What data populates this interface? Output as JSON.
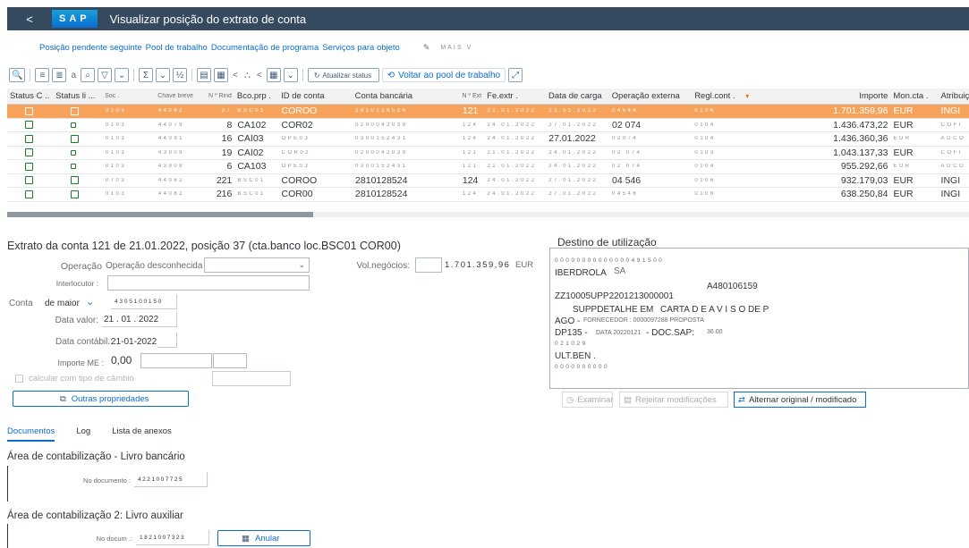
{
  "shell": {
    "back": "<",
    "logo": "SAP",
    "title": "Visualizar posição do extrato de conta"
  },
  "appmenu": {
    "items": [
      "Posição pendente seguinte",
      "Pool de trabalho",
      "Documentação de programa",
      "Serviços para objeto"
    ],
    "more": "MAIS V"
  },
  "toolbar": {
    "a_label": "a",
    "refresh_label": "Atualizar status",
    "back_pool_label": "Voltar ao pool de trabalho"
  },
  "table": {
    "columns": [
      "Status C ..",
      "Status li ...",
      "Soc .",
      "Chave breve",
      "N º Rind",
      "Bco.prp .",
      "ID de conta",
      "Conta bancária",
      "N º Ext",
      "Fe.extr .",
      "Data de carga",
      "Operação externa",
      "Regl.cont .",
      "Importe",
      "Mon.cta .",
      "Atribuição"
    ],
    "rows": [
      {
        "soc": "0103",
        "chave": "44062",
        "rind": "37",
        "bco": "BSC01",
        "idconta": "COROO",
        "conta": "2810128524",
        "ext": "121",
        "fe": "21.01.2022",
        "carga": "21.01.2022",
        "op": "04546",
        "regl": "0106",
        "importe": "1.701.359,96",
        "moneda": "EUR",
        "atrib": "INGI"
      },
      {
        "soc": "0103",
        "chave": "44079",
        "rind": "8",
        "bco": "CA102",
        "idconta": "COR02",
        "conta": "0200042039",
        "ext": "124",
        "fe": "24.01.2022",
        "carga": "27.01.2022",
        "op": "02 074",
        "regl": "0104",
        "importe": "1.436.473,22",
        "moneda": "EUR",
        "atrib": "COFI"
      },
      {
        "soc": "0103",
        "chave": "44091",
        "rind": "16",
        "bco": "CAI03",
        "idconta": "OPE03",
        "conta": "0300152431",
        "ext": "124",
        "fe": "24.01.2022",
        "carga": "27.01.2022",
        "op": "02074",
        "regl": "0104",
        "importe": "1.436.360,36",
        "moneda": "EUR",
        "atrib": "AGCO"
      },
      {
        "soc": "0103",
        "chave": "43909",
        "rind": "19",
        "bco": "CAI02",
        "idconta": "COR02",
        "conta": "0200042039",
        "ext": "121",
        "fe": "21.01.2022",
        "carga": "24.01.2022",
        "op": "02 074",
        "regl": "0103",
        "importe": "1.043.137,33",
        "moneda": "EUR",
        "atrib": "COFI"
      },
      {
        "soc": "0103",
        "chave": "43908",
        "rind": "6",
        "bco": "CA103",
        "idconta": "OPE03",
        "conta": "0300152431",
        "ext": "121",
        "fe": "21.01.2022",
        "carga": "24.01.2022",
        "op": "02 074",
        "regl": "0104",
        "importe": "955.292,66",
        "moneda": "EUR",
        "atrib": "AGCO"
      },
      {
        "soc": "0703",
        "chave": "44062",
        "rind": "221",
        "bco": "BSC01",
        "idconta": "COROO",
        "conta": "2810128524",
        "ext": "124",
        "fe": "24.01.2022",
        "carga": "27.01.2022",
        "op": "04 546",
        "regl": "0106",
        "importe": "932.179,03",
        "moneda": "EUR",
        "atrib": "INGI"
      },
      {
        "soc": "0103",
        "chave": "44062",
        "rind": "216",
        "bco": "BSC01",
        "idconta": "COR00",
        "conta": "2810128524",
        "ext": "124",
        "fe": "24.01.2022",
        "carga": "27.01.2022",
        "op": "04546",
        "regl": "0106",
        "importe": "638.250,84",
        "moneda": "EUR",
        "atrib": "INGI"
      }
    ]
  },
  "detail": {
    "title": "Extrato da conta 121 de 21.01.2022, posição 37 (cta.banco loc.BSC01 COR00)",
    "operacao_label": "Operação",
    "operacao_value": "Operação desconhecida",
    "volnegocios_label": "Vol.negócios:",
    "volnegocios_value": "1.701.359,96",
    "volnegocios_currency": "EUR",
    "interlocutor_label": "Interlocutor :",
    "conta_label": "Conta",
    "conta_type": "de maior",
    "conta_value": "4305100150",
    "data_valor_label": "Data valor:",
    "data_valor_value": "21 . 01 . 2022",
    "data_contabil_label": "Data contábil.:",
    "data_contabil_value": "21-01-2022",
    "importe_me_label": "Importe ME :",
    "importe_me_value": "0,00",
    "cambio_label": "calcular com tipo de câmbio",
    "outras_label": "Outras propriedades"
  },
  "tabs": [
    "Documentos",
    "Log",
    "Lista de anexos"
  ],
  "area1": {
    "title": "Área de contabilização - Livro bancário",
    "doc_label": "No documento :",
    "doc_value": "4221007725"
  },
  "area2": {
    "title": "Área de contabilização 2: Livro auxiliar",
    "doc_label": "No docum .:",
    "doc_value": "1821007323",
    "anular_label": "Anular"
  },
  "destino": {
    "title": "Destino de utilização",
    "line1": "00000000000000491500",
    "line2": "IBERDROLA",
    "line2b": "SA",
    "line3": "A480106159",
    "line4": "ZZ10005UPP2201213000001",
    "line5a": "SUPPDETALHE EM",
    "line5b": "CARTA D E A V I S O DE P",
    "line6a": "AGO -",
    "line6b": "FORNECEDOR : 0000097288 PROPOSTA",
    "line7a": "DP135 -",
    "line7b": "DATA 20220121",
    "line7c": "- DOC.SAP:",
    "line7d": "36 00",
    "line8": "021029",
    "line9": "ULT.BEN .",
    "line10": "0000000000",
    "examinar": "Examinar",
    "rejeitar": "Rejeitar modificações",
    "alternar": "Alternar original / modificado"
  },
  "colors": {
    "shell": "#354a5f",
    "selected_row": "#f7a35c",
    "accent": "#0a6ed1",
    "status_green": "#1b7d2a"
  }
}
